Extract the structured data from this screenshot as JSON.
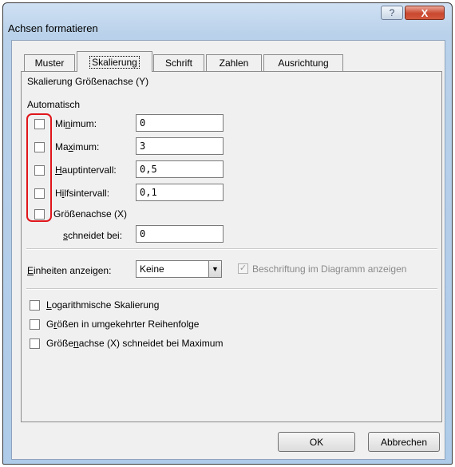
{
  "window": {
    "title": "Achsen formatieren",
    "help_icon": "?",
    "close_icon": "X"
  },
  "tabs": [
    {
      "label": "Muster",
      "active": false
    },
    {
      "label": "Skalierung",
      "active": true
    },
    {
      "label": "Schrift",
      "active": false
    },
    {
      "label": "Zahlen",
      "active": false
    },
    {
      "label": "Ausrichtung",
      "active": false
    }
  ],
  "scaling": {
    "heading": "Skalierung Größenachse (Y)",
    "auto_label": "Automatisch",
    "fields": [
      {
        "pre": "Mi",
        "key": "n",
        "post": "imum:",
        "value": "0",
        "checked": false
      },
      {
        "pre": "Ma",
        "key": "x",
        "post": "imum:",
        "value": "3",
        "checked": false
      },
      {
        "pre": "",
        "key": "H",
        "post": "auptintervall:",
        "value": "0,5",
        "checked": false
      },
      {
        "pre": "H",
        "key": "i",
        "post": "lfsintervall:",
        "value": "0,1",
        "checked": false
      }
    ],
    "crosses": {
      "line1": "Größenachse (X)",
      "line2_key": "s",
      "line2_rest": "chneidet bei:",
      "value": "0",
      "checked": false
    }
  },
  "units": {
    "label_key": "E",
    "label_rest": "inheiten anzeigen:",
    "selected": "Keine",
    "show_label": "Beschriftung im Diagramm anzeigen",
    "show_checked": true
  },
  "options": [
    {
      "key": "L",
      "rest": "ogarithmische Skalierung",
      "checked": false
    },
    {
      "pre": "G",
      "key": "r",
      "rest": "ößen in umgekehrter Reihenfolge",
      "checked": false
    },
    {
      "pre": "Größe",
      "key": "n",
      "rest": "achse (X) schneidet bei Maximum",
      "checked": false
    }
  ],
  "buttons": {
    "ok": "OK",
    "cancel": "Abbrechen"
  },
  "colors": {
    "highlight": "#e0161b",
    "close_button": "#c9472f",
    "dialog_bg": "#f0f0f0"
  }
}
